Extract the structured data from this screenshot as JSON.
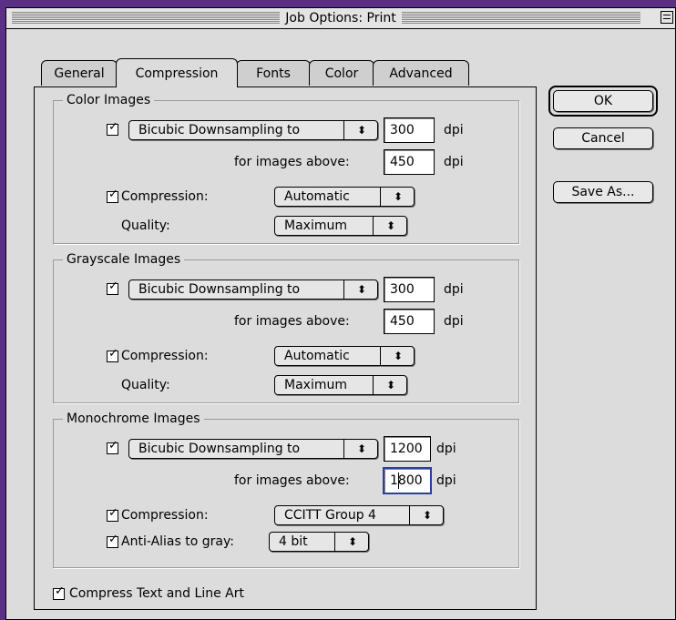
{
  "window": {
    "title": "Job Options: Print"
  },
  "tabs": [
    {
      "label": "General"
    },
    {
      "label": "Compression"
    },
    {
      "label": "Fonts"
    },
    {
      "label": "Color"
    },
    {
      "label": "Advanced"
    }
  ],
  "active_tab": "Compression",
  "buttons": {
    "ok": "OK",
    "cancel": "Cancel",
    "save_as": "Save As..."
  },
  "common": {
    "dpi": "dpi",
    "for_images_above": "for images above:",
    "compression": "Compression:",
    "quality": "Quality:",
    "check_mark": "✓",
    "popup_arrows": "⬍"
  },
  "color_images": {
    "title": "Color Images",
    "downsampling": {
      "checked": true,
      "method": "Bicubic Downsampling to",
      "resolution": "300",
      "above": "450"
    },
    "compression": {
      "checked": true,
      "value": "Automatic"
    },
    "quality": "Maximum"
  },
  "grayscale_images": {
    "title": "Grayscale Images",
    "downsampling": {
      "checked": true,
      "method": "Bicubic Downsampling to",
      "resolution": "300",
      "above": "450"
    },
    "compression": {
      "checked": true,
      "value": "Automatic"
    },
    "quality": "Maximum"
  },
  "monochrome_images": {
    "title": "Monochrome Images",
    "downsampling": {
      "checked": true,
      "method": "Bicubic Downsampling to",
      "resolution": "1200",
      "above": "1800"
    },
    "compression": {
      "checked": true,
      "value": "CCITT Group 4"
    },
    "anti_alias": {
      "checked": true,
      "label": "Anti-Alias to gray:",
      "value": "4 bit"
    }
  },
  "compress_text": {
    "checked": true,
    "label": "Compress Text and Line Art"
  }
}
